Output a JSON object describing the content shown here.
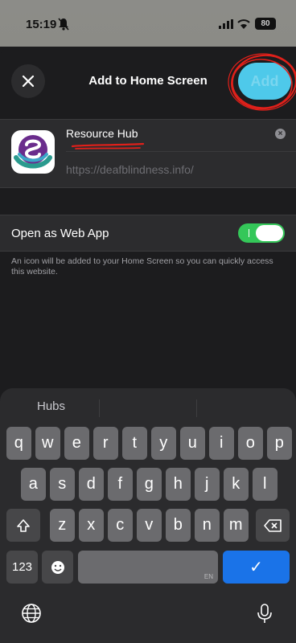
{
  "status": {
    "time": "15:19",
    "battery": "80",
    "bell_icon": "bell-slash-icon"
  },
  "header": {
    "title": "Add to Home Screen",
    "add_label": "Add",
    "close_icon": "close-icon"
  },
  "card": {
    "name": "Resource Hub",
    "url": "https://deafblindness.info/"
  },
  "setting": {
    "label": "Open as Web App",
    "enabled": true,
    "note": "An icon will be added to your Home Screen so you can quickly access this website."
  },
  "keyboard": {
    "suggestions": [
      "Hubs",
      "",
      ""
    ],
    "row1": [
      "q",
      "w",
      "e",
      "r",
      "t",
      "y",
      "u",
      "i",
      "o",
      "p"
    ],
    "row2": [
      "a",
      "s",
      "d",
      "f",
      "g",
      "h",
      "j",
      "k",
      "l"
    ],
    "row3": [
      "z",
      "x",
      "c",
      "v",
      "b",
      "n",
      "m"
    ],
    "num_label": "123",
    "space_lang": "EN",
    "done_label": "✓"
  },
  "colors": {
    "accent": "#4ec9ea",
    "toggle_on": "#34c759",
    "done_key": "#1a73e8",
    "annotation": "#e0201a"
  }
}
